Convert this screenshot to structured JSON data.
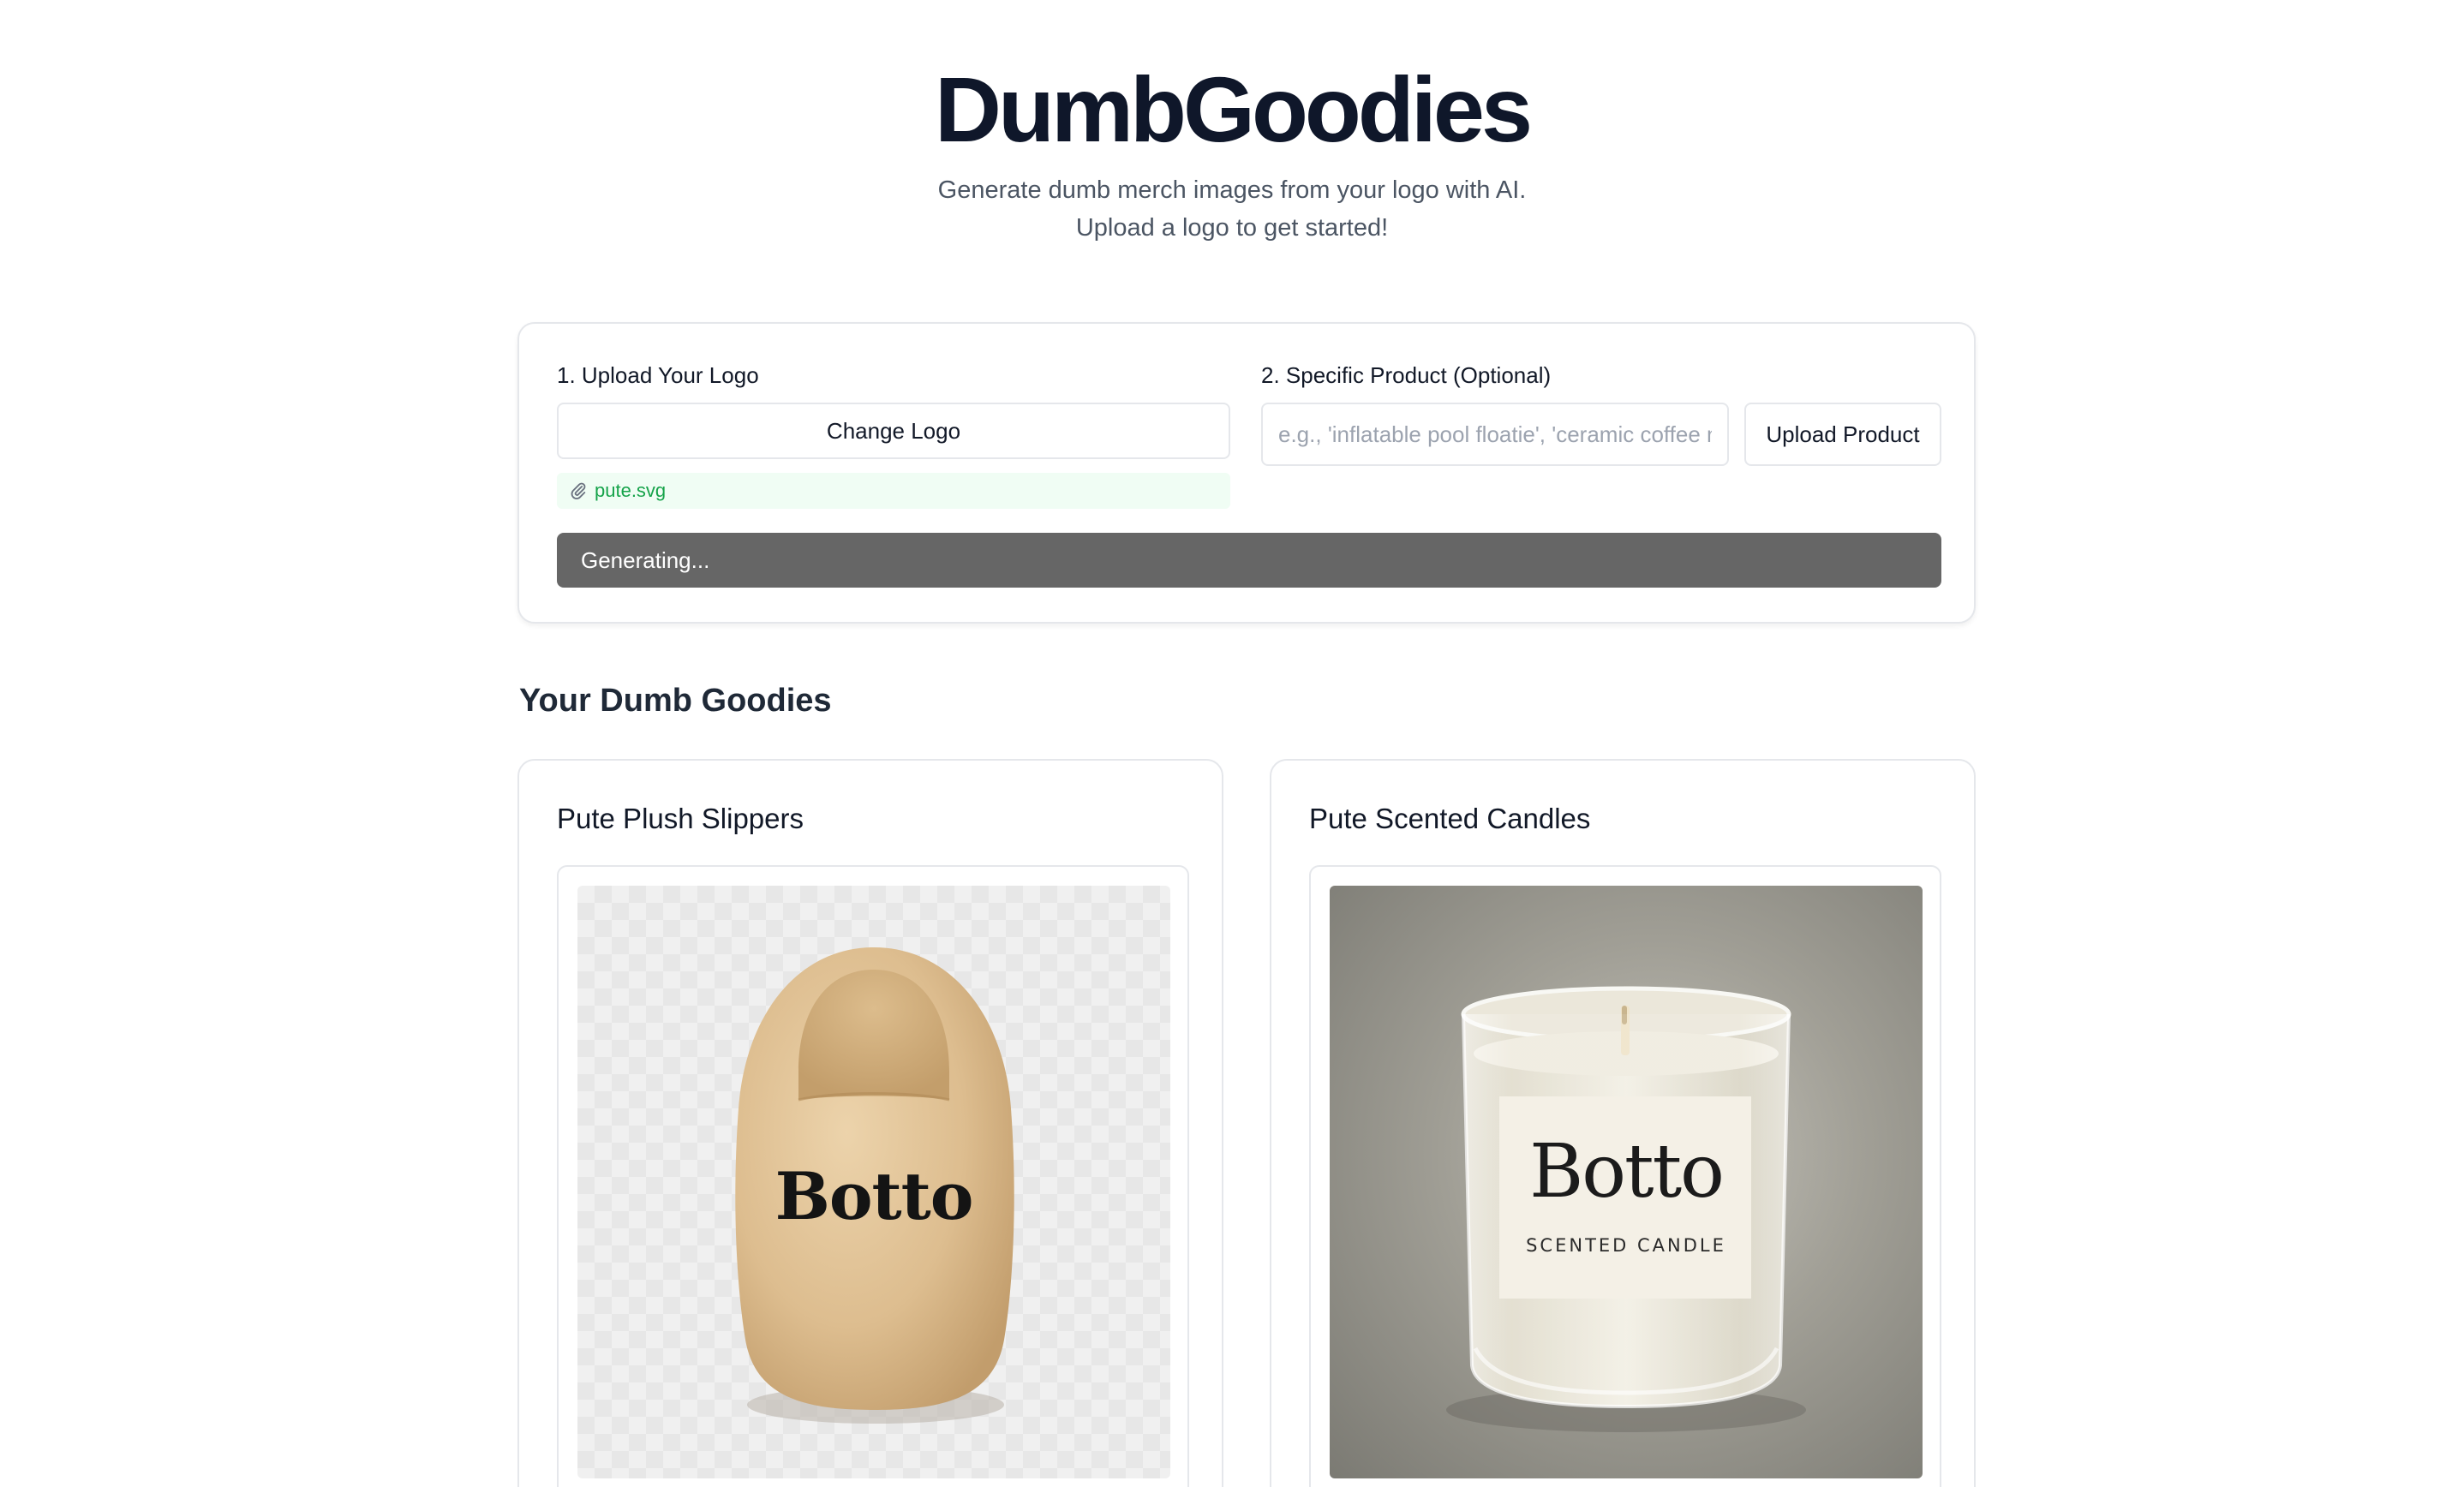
{
  "header": {
    "title": "DumbGoodies",
    "subtitle_line1": "Generate dumb merch images from your logo with AI.",
    "subtitle_line2": "Upload a logo to get started!"
  },
  "form": {
    "upload_label": "1. Upload Your Logo",
    "change_logo_label": "Change Logo",
    "file_name": "pute.svg",
    "file_icon": "paperclip-icon",
    "product_label": "2. Specific Product (Optional)",
    "product_placeholder": "e.g., 'inflatable pool floatie', 'ceramic coffee mug'",
    "product_value": "",
    "upload_product_label": "Upload Product",
    "generate_label": "Generating..."
  },
  "results": {
    "title": "Your Dumb Goodies",
    "items": [
      {
        "title": "Pute Plush Slippers",
        "image_text": "Botto"
      },
      {
        "title": "Pute Scented Candles",
        "image_text": "Botto",
        "image_subtext": "SCENTED CANDLE"
      }
    ]
  },
  "colors": {
    "title": "#0f172a",
    "generate_button_bg": "#666666",
    "file_chip_bg": "#f0fdf4",
    "file_chip_text": "#16a34a",
    "border": "#e5e7eb"
  }
}
